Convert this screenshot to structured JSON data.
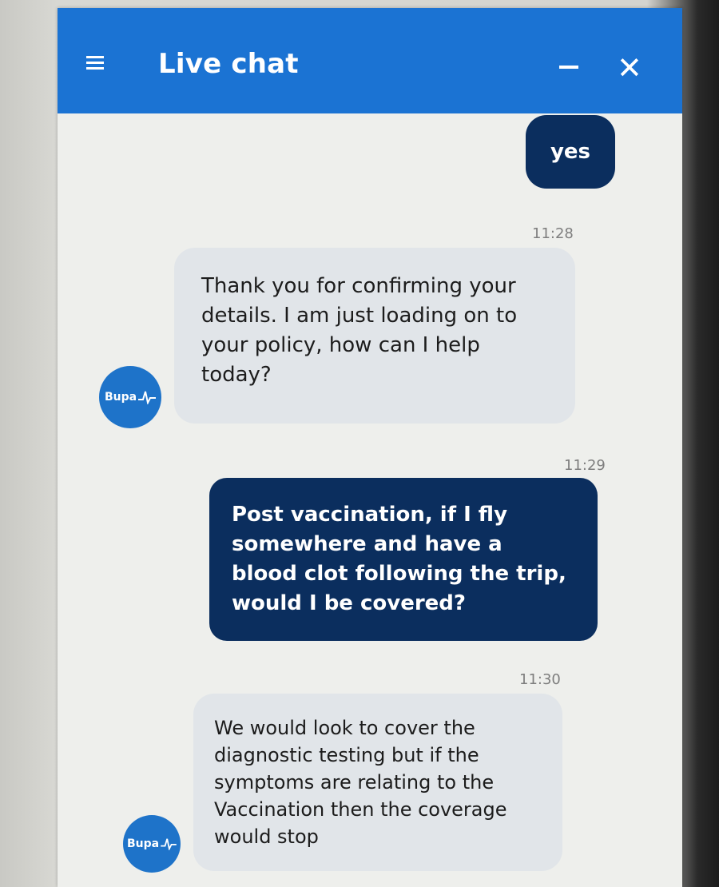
{
  "header": {
    "title": "Live chat",
    "close_glyph": "✕"
  },
  "avatar": {
    "label": "Bupa"
  },
  "messages": [
    {
      "from": "user",
      "text": "yes"
    },
    {
      "time": "11:28"
    },
    {
      "from": "agent",
      "text": "Thank you for confirming your details. I am just loading on to your policy, how can I help today?"
    },
    {
      "time": "11:29"
    },
    {
      "from": "user",
      "text": "Post vaccination, if I fly somewhere and have a blood clot following the trip, would I be covered?"
    },
    {
      "time": "11:30"
    },
    {
      "from": "agent",
      "text": "We would look to cover the diagnostic testing but if the symptoms are relating to the Vaccination then the coverage would stop"
    }
  ],
  "colors": {
    "header": "#1b73d3",
    "user_bubble": "#0b2e5e",
    "agent_bubble": "#e1e5e9",
    "avatar": "#1e73c9"
  },
  "icons": [
    "menu-icon",
    "minimize-icon",
    "close-icon",
    "heartbeat-icon"
  ]
}
